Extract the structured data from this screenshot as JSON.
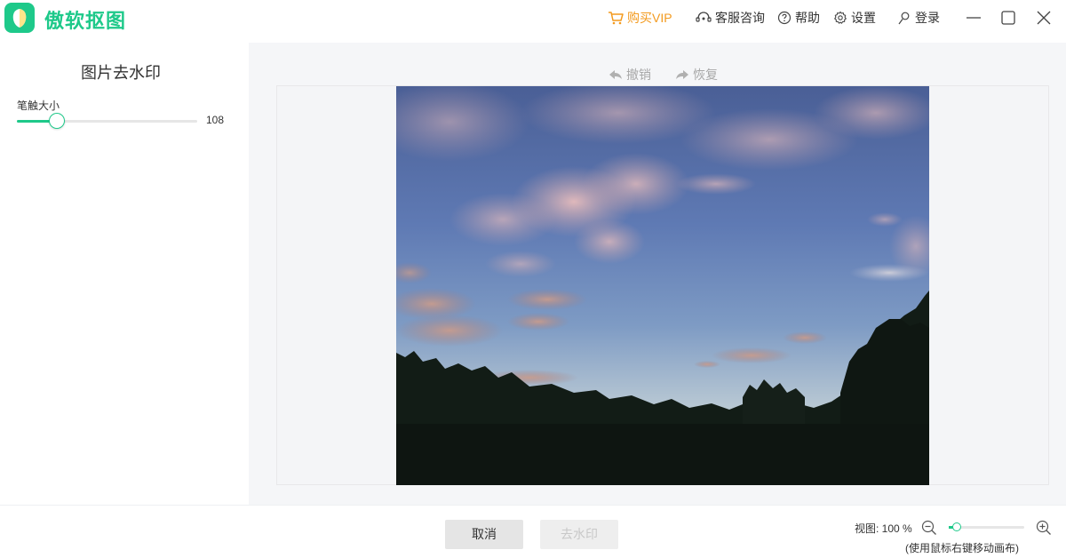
{
  "app": {
    "name": "傲软抠图",
    "brand_color": "#1ec98a"
  },
  "titlebar": {
    "vip_label": "购买VIP",
    "vip_color": "#f39a1e",
    "service_label": "客服咨询",
    "help_label": "帮助",
    "settings_label": "设置",
    "login_label": "登录",
    "icons": [
      "cart-icon",
      "headset-icon",
      "help-icon",
      "gear-icon",
      "user-icon",
      "minimize-icon",
      "maximize-icon",
      "close-icon"
    ]
  },
  "left_panel": {
    "title": "图片去水印",
    "brush_label": "笔触大小",
    "brush_value": "108",
    "brush_fraction": 0.22
  },
  "toolbar": {
    "undo_label": "撤销",
    "redo_label": "恢复"
  },
  "bottom": {
    "cancel_label": "取消",
    "remove_label": "去水印",
    "zoom_label": "视图: 100 %",
    "zoom_fraction": 0.1,
    "hint": "(使用鼠标右键移动画布)"
  }
}
